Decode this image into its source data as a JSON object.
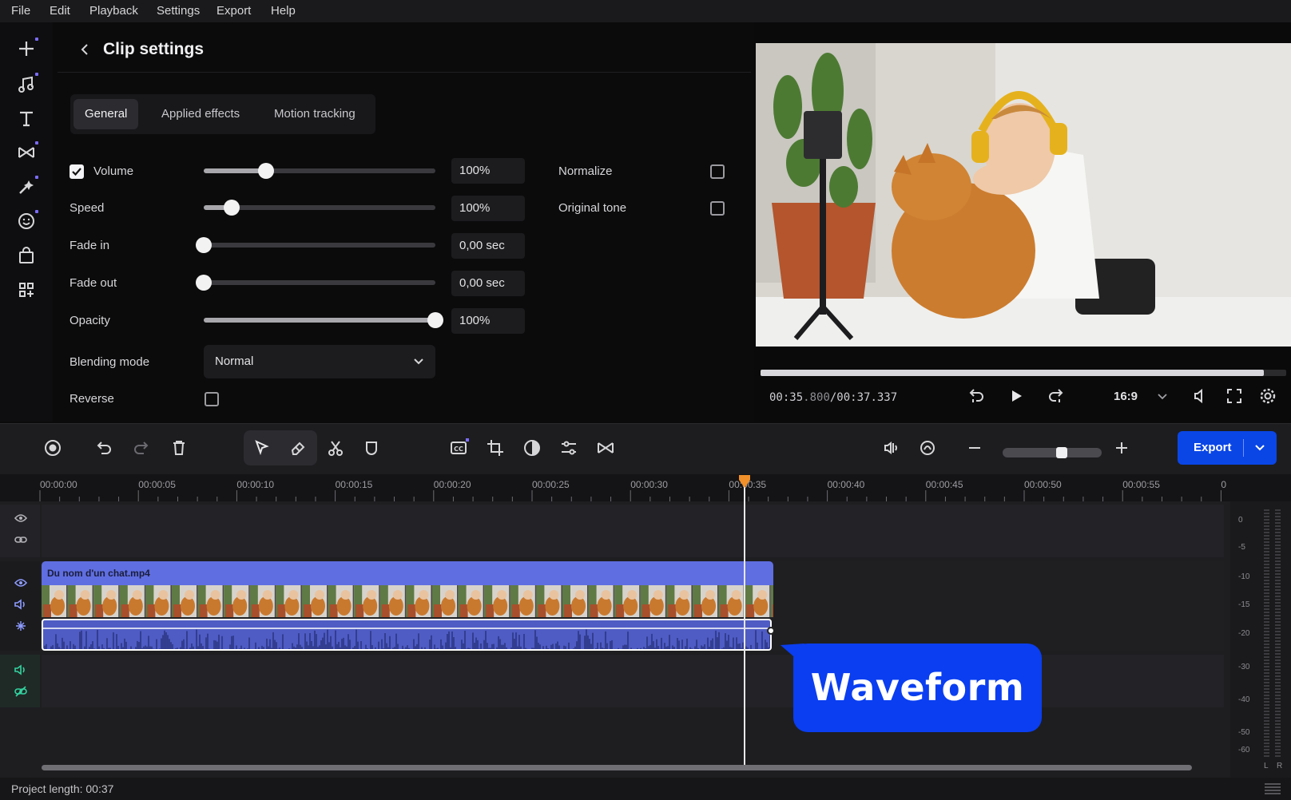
{
  "menu": [
    "File",
    "Edit",
    "Playback",
    "Settings",
    "Export",
    "Help"
  ],
  "settings": {
    "title": "Clip settings",
    "tabs": [
      "General",
      "Applied effects",
      "Motion tracking"
    ],
    "active_tab": "General",
    "rows": [
      {
        "label": "Volume",
        "value": "100%",
        "level": 0.27,
        "checked": true
      },
      {
        "label": "Speed",
        "value": "100%",
        "level": 0.12
      },
      {
        "label": "Fade in",
        "value": "0,00 sec",
        "level": 0.0
      },
      {
        "label": "Fade out",
        "value": "0,00 sec",
        "level": 0.0
      },
      {
        "label": "Opacity",
        "value": "100%",
        "level": 1.0
      }
    ],
    "normalize_label": "Normalize",
    "original_tone_label": "Original tone",
    "normalize_checked": false,
    "original_tone_checked": false,
    "blending_label": "Blending mode",
    "blending_value": "Normal",
    "reverse_label": "Reverse",
    "reverse_checked": false
  },
  "player": {
    "timecode_current": "00:35",
    "timecode_ms": ".800",
    "timecode_total": "/00:37.337",
    "progress": 0.957,
    "aspect": "16:9"
  },
  "toolbar": {
    "export_label": "Export",
    "zoom_level": 0.6
  },
  "timeline": {
    "ruler": [
      "00:00:00",
      "00:00:05",
      "00:00:10",
      "00:00:15",
      "00:00:20",
      "00:00:25",
      "00:00:30",
      "00:00:35",
      "00:00:40",
      "00:00:45",
      "00:00:50",
      "00:00:55",
      "0"
    ],
    "playhead_time": "00:00:35",
    "clip_name": "Du nom d'un chat.mp4",
    "meter_labels": [
      "0",
      "-5",
      "-10",
      "-15",
      "-20",
      "-30",
      "-40",
      "-50",
      "-60"
    ],
    "meter_channels": [
      "L",
      "R"
    ]
  },
  "callout": "Waveform",
  "status": {
    "project_length": "Project length: 00:37"
  },
  "colors": {
    "accent": "#0a46e6",
    "clip": "#5f6ee0",
    "playhead": "#f0902a",
    "callout": "#0a3ef0"
  }
}
